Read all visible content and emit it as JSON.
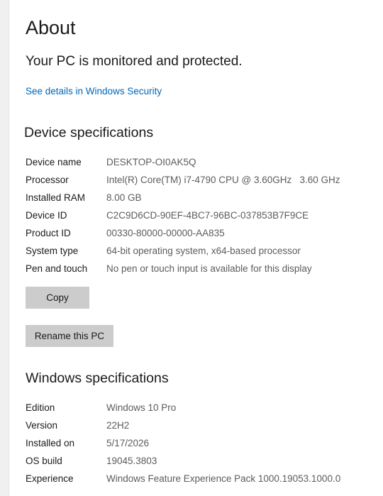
{
  "page": {
    "title": "About",
    "protection_status": "Your PC is monitored and protected.",
    "security_link": "See details in Windows Security"
  },
  "device_specs": {
    "heading": "Device specifications",
    "rows": [
      {
        "label": "Device name",
        "value": "DESKTOP-OI0AK5Q"
      },
      {
        "label": "Processor",
        "value": "Intel(R) Core(TM) i7-4790 CPU @ 3.60GHz   3.60 GHz"
      },
      {
        "label": "Installed RAM",
        "value": "8.00 GB"
      },
      {
        "label": "Device ID",
        "value": "C2C9D6CD-90EF-4BC7-96BC-037853B7F9CE"
      },
      {
        "label": "Product ID",
        "value": "00330-80000-00000-AA835"
      },
      {
        "label": "System type",
        "value": "64-bit operating system, x64-based processor"
      },
      {
        "label": "Pen and touch",
        "value": "No pen or touch input is available for this display"
      }
    ],
    "copy_label": "Copy",
    "rename_label": "Rename this PC"
  },
  "windows_specs": {
    "heading": "Windows specifications",
    "rows": [
      {
        "label": "Edition",
        "value": "Windows 10 Pro"
      },
      {
        "label": "Version",
        "value": "22H2"
      },
      {
        "label": "Installed on",
        "value": "5/17/2026"
      },
      {
        "label": "OS build",
        "value": "19045.3803"
      },
      {
        "label": "Experience",
        "value": "Windows Feature Experience Pack 1000.19053.1000.0"
      }
    ]
  },
  "colors": {
    "link": "#0067b8",
    "button_bg": "#cccccc",
    "value_text": "#5c5c5c"
  }
}
